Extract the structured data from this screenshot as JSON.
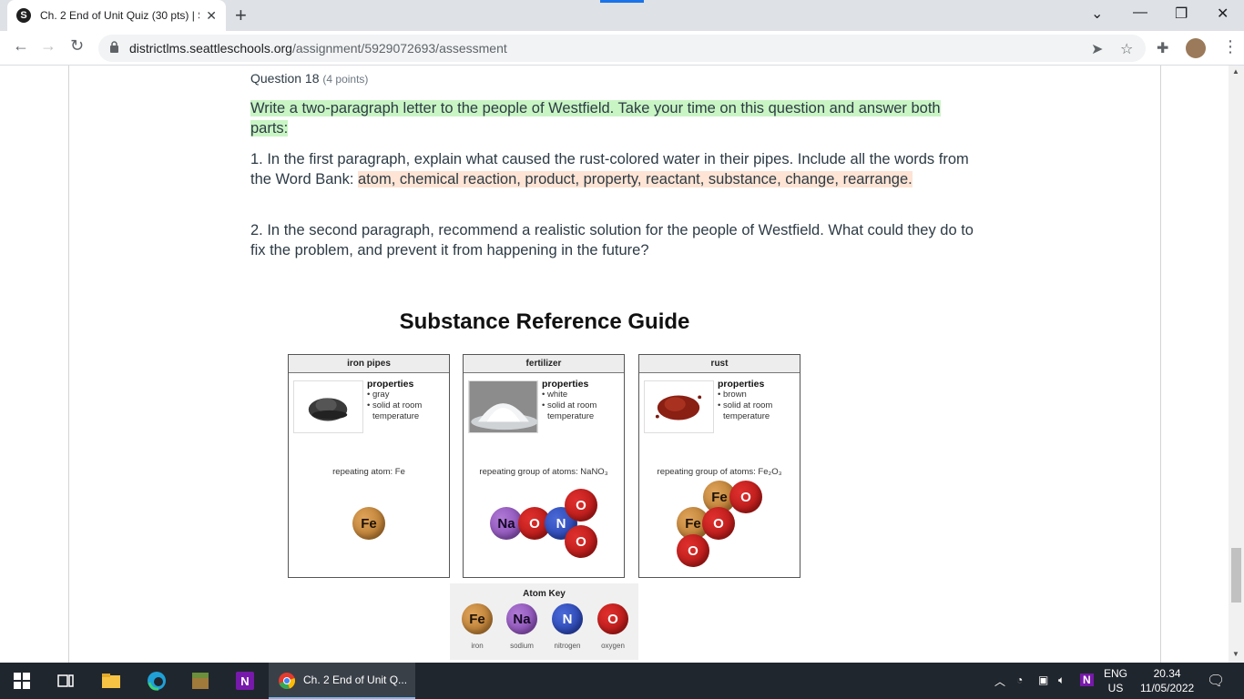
{
  "browser": {
    "tab_title": "Ch. 2 End of Unit Quiz (30 pts) | S",
    "tab_favicon": "S",
    "url_host": "districtlms.seattleschools.org",
    "url_path": "/assignment/5929072693/assessment"
  },
  "question": {
    "title": "Question 18",
    "points": "(4 points)",
    "intro": "Write a two-paragraph letter to the people of Westfield.  Take your time on this question and answer both parts:",
    "part1_start": "1. In the first paragraph, explain what caused the rust-colored water in their pipes. Include all the words from the Word Bank: ",
    "part1_wordbank": "atom, chemical reaction, product, property, reactant, substance, change, rearrange.",
    "part2": "2. In the second paragraph, recommend a realistic solution for the people of Westfield. What could they do to fix the problem, and prevent it from happening in the future?"
  },
  "figure": {
    "title": "Substance Reference Guide",
    "properties_label": "properties",
    "cards": [
      {
        "name": "iron pipes",
        "prop1": "• gray",
        "prop2": "• solid at room",
        "prop3": "temperature",
        "repeat": "repeating atom: Fe"
      },
      {
        "name": "fertilizer",
        "prop1": "• white",
        "prop2": "• solid at room",
        "prop3": "temperature",
        "repeat": "repeating group of atoms: NaNO₃"
      },
      {
        "name": "rust",
        "prop1": "• brown",
        "prop2": "• solid at room",
        "prop3": "temperature",
        "repeat": "repeating group of atoms: Fe₂O₃"
      }
    ],
    "atoms": {
      "fe": "Fe",
      "na": "Na",
      "n": "N",
      "o": "O"
    },
    "atom_key": {
      "title": "Atom Key",
      "labels": [
        "iron",
        "sodium",
        "nitrogen",
        "oxygen"
      ]
    }
  },
  "taskbar": {
    "active_app": "Ch. 2 End of Unit Q...",
    "lang1": "ENG",
    "lang2": "US",
    "time": "20.34",
    "date": "11/05/2022"
  },
  "colors": {
    "highlight_green": "#c9f5c4",
    "highlight_peach": "#fde4d4",
    "iron": "#c08540",
    "sodium": "#9a5cc4",
    "nitrogen": "#2a47b8",
    "oxygen": "#c91d1b"
  }
}
